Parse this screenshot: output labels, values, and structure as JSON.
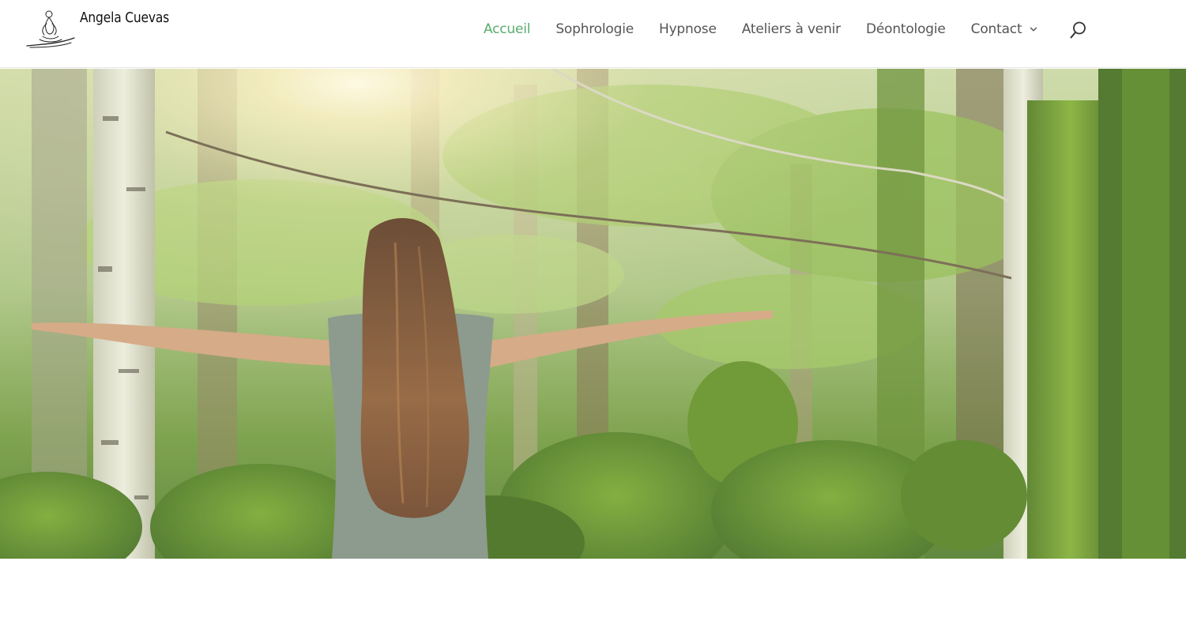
{
  "site": {
    "brand_name": "Angela Cuevas",
    "logo_icon": "meditating-figure-icon"
  },
  "nav": {
    "items": [
      {
        "label": "Accueil",
        "active": true
      },
      {
        "label": "Sophrologie",
        "active": false
      },
      {
        "label": "Hypnose",
        "active": false
      },
      {
        "label": "Ateliers à venir",
        "active": false
      },
      {
        "label": "Déontologie",
        "active": false
      },
      {
        "label": "Contact",
        "active": false,
        "has_dropdown": true
      }
    ],
    "search_icon": "search-icon"
  },
  "hero": {
    "image_description_icon": "forest-woman-arms-open-image"
  },
  "colors": {
    "accent": "#5aad6e",
    "nav_text": "#555555"
  }
}
